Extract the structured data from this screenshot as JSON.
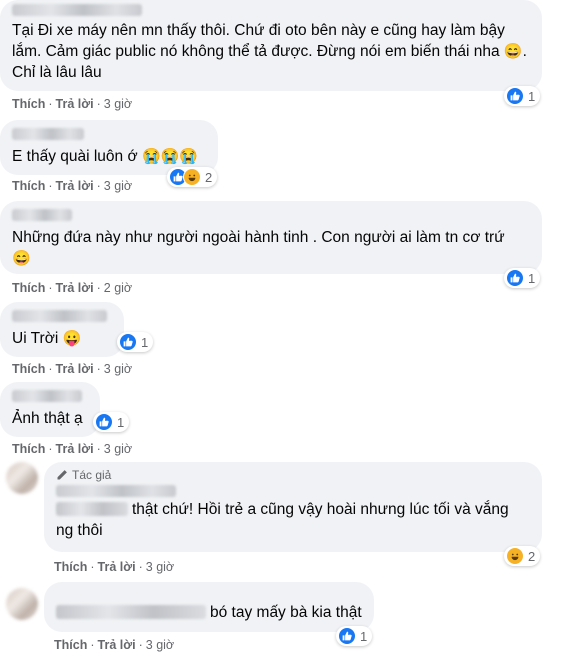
{
  "actions": {
    "like": "Thích",
    "reply": "Trả lời",
    "sep": "·"
  },
  "comments": [
    {
      "text": "Tại Đi xe máy nên mn thấy thôi. Chứ đi oto bên này e cũng hay làm bậy lắm. Cảm giác public nó không thể tả được. Đừng nói em biến thái nha",
      "text_tail": "Chỉ là lâu lâu",
      "emoji": "😄",
      "time": "3 giờ",
      "reaction_count": "1"
    },
    {
      "text": "E thấy quài luôn ớ",
      "emoji": "😭😭😭",
      "time": "3 giờ",
      "reaction_count": "2"
    },
    {
      "text": "Những đứa này như người ngoài hành tinh . Con người ai làm tn cơ trứ",
      "emoji": "😄",
      "time": "2 giờ",
      "reaction_count": "1"
    },
    {
      "text": "Ui Trời",
      "emoji": "😛",
      "time": "3 giờ",
      "reaction_count": "1"
    },
    {
      "text": "Ảnh thật ạ",
      "time": "3 giờ",
      "reaction_count": "1"
    }
  ],
  "replies": [
    {
      "author_badge": "Tác giả",
      "text": "thật chứ! Hồi trẻ a cũng vậy hoài nhưng lúc tối và vắng ng thôi",
      "time": "3 giờ",
      "reaction_count": "2"
    },
    {
      "text": "bó tay mấy bà kia thật",
      "time": "3 giờ",
      "reaction_count": "1"
    }
  ],
  "icons": {
    "like": "thumbs-up-icon",
    "haha": "haha-icon",
    "author": "pencil-icon"
  },
  "colors": {
    "like": "#1877f2",
    "haha": "#f7b125",
    "bubble": "#f0f2f5",
    "meta": "#65676b"
  }
}
